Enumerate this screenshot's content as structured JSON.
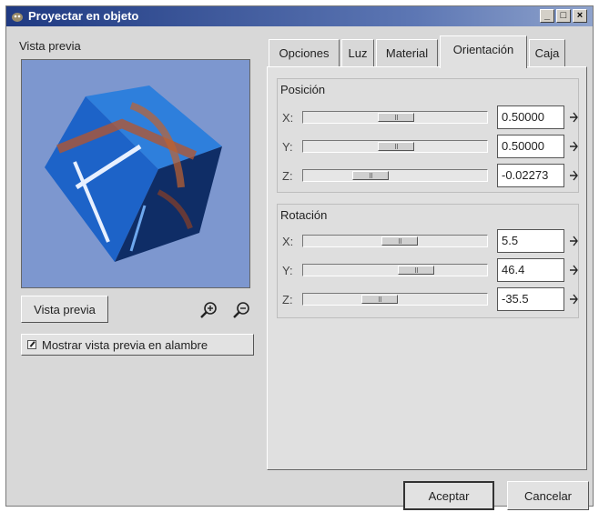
{
  "window": {
    "title": "Proyectar en objeto"
  },
  "titlebar_buttons": [
    "_",
    "□",
    "×"
  ],
  "preview": {
    "label": "Vista previa",
    "button_label": "Vista previa",
    "wireframe_label": "Mostrar vista previa en alambre",
    "wireframe_checked": true
  },
  "tabs": [
    {
      "label": "Opciones",
      "active": false
    },
    {
      "label": "Luz",
      "active": false
    },
    {
      "label": "Material",
      "active": false
    },
    {
      "label": "Orientación",
      "active": true
    },
    {
      "label": "Caja",
      "active": false
    }
  ],
  "position": {
    "title": "Posición",
    "rows": [
      {
        "axis": "X:",
        "value": "0.50000",
        "slider_fraction": 0.5
      },
      {
        "axis": "Y:",
        "value": "0.50000",
        "slider_fraction": 0.5
      },
      {
        "axis": "Z:",
        "value": "-0.02273",
        "slider_fraction": 0.36
      }
    ]
  },
  "rotation": {
    "title": "Rotación",
    "rows": [
      {
        "axis": "X:",
        "value": "5.5",
        "slider_fraction": 0.52
      },
      {
        "axis": "Y:",
        "value": "46.4",
        "slider_fraction": 0.63
      },
      {
        "axis": "Z:",
        "value": "-35.5",
        "slider_fraction": 0.4
      }
    ]
  },
  "buttons": {
    "accept": "Aceptar",
    "cancel": "Cancelar"
  },
  "colors": {
    "titlebar": "#1f3a82",
    "preview_bg": "#7d97cf",
    "cube": "#1d63c8"
  }
}
